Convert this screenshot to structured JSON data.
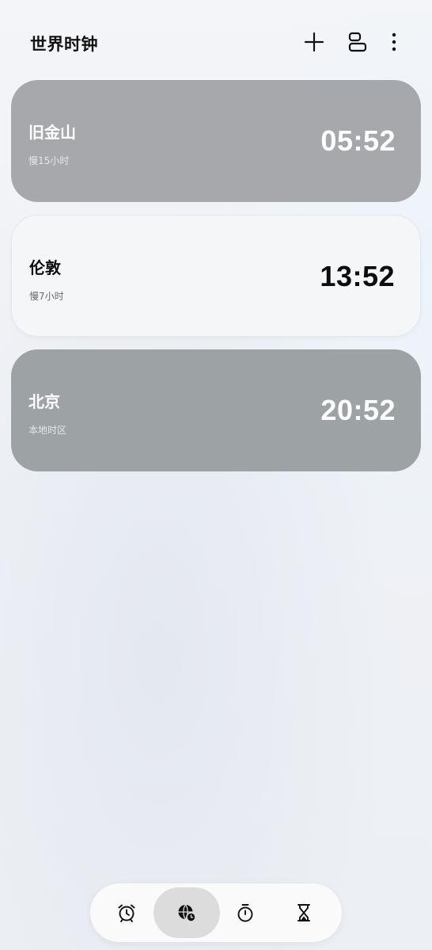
{
  "header": {
    "title": "世界时钟",
    "actions": [
      {
        "icon": "add-icon"
      },
      {
        "icon": "layout-toggle-icon"
      },
      {
        "icon": "more-vertical-icon"
      }
    ]
  },
  "clocks": [
    {
      "city": "旧金山",
      "offset": "慢15小时",
      "time": "05:52",
      "style": "dark"
    },
    {
      "city": "伦敦",
      "offset": "慢7小时",
      "time": "13:52",
      "style": "light"
    },
    {
      "city": "北京",
      "offset": "本地时区",
      "time": "20:52",
      "style": "dark"
    }
  ],
  "bottom_nav": {
    "items": [
      {
        "icon": "alarm-clock-icon",
        "active": false
      },
      {
        "icon": "world-clock-icon",
        "active": true
      },
      {
        "icon": "stopwatch-icon",
        "active": false
      },
      {
        "icon": "timer-hourglass-icon",
        "active": false
      }
    ]
  },
  "colors": {
    "dark_card": "#a7a8ab",
    "light_card": "#f5f6f8",
    "active_nav": "#dcdcdc"
  }
}
